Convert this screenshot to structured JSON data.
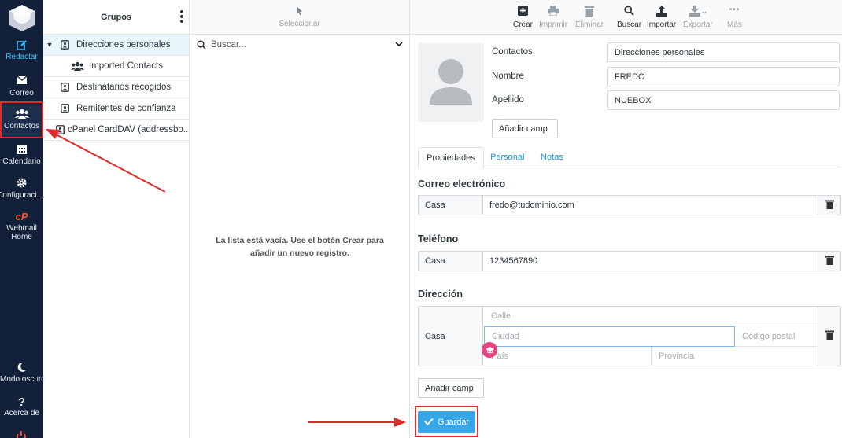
{
  "nav": {
    "items": [
      {
        "label": "Redactar",
        "icon": "compose-icon"
      },
      {
        "label": "Correo",
        "icon": "mail-icon"
      },
      {
        "label": "Contactos",
        "icon": "users-icon"
      },
      {
        "label": "Calendario",
        "icon": "calendar-icon"
      },
      {
        "label": "Configuraci...",
        "icon": "gear-icon"
      },
      {
        "label": "Webmail Home",
        "icon": "cpanel-icon"
      },
      {
        "label": "Modo oscuro",
        "icon": "moon-icon"
      },
      {
        "label": "Acerca de",
        "icon": "question-icon"
      }
    ]
  },
  "groups": {
    "title": "Grupos",
    "items": [
      {
        "label": "Direcciones personales"
      },
      {
        "label": "Imported Contacts"
      },
      {
        "label": "Destinatarios recogidos"
      },
      {
        "label": "Remitentes de confianza"
      },
      {
        "label": "cPanel CardDAV (addressbo..."
      }
    ]
  },
  "list": {
    "select_label": "Seleccionar",
    "search_placeholder": "Buscar...",
    "empty_message_line1": "La lista está vacía. Use el botón Crear para",
    "empty_message_line2": "añadir un nuevo registro."
  },
  "toolbar": {
    "create": "Crear",
    "print": "Imprimir",
    "delete": "Eliminar",
    "search": "Buscar",
    "import": "Importar",
    "export": "Exportar",
    "more": "Más"
  },
  "contact": {
    "label_contacts": "Contactos",
    "addressbook": "Direcciones personales",
    "label_name": "Nombre",
    "name": "FREDO",
    "label_surname": "Apellido",
    "surname": "NUEBOX",
    "add_field_top": "Añadir camp",
    "tabs": [
      "Propiedades",
      "Personal",
      "Notas"
    ],
    "email_section": "Correo electrónico",
    "email_type": "Casa",
    "email_value": "fredo@tudominio.com",
    "phone_section": "Teléfono",
    "phone_type": "Casa",
    "phone_value": "1234567890",
    "address_section": "Dirección",
    "address_type": "Casa",
    "street_ph": "Calle",
    "city_ph": "Ciudad",
    "zip_ph": "Código postal",
    "country_ph": "País",
    "province_ph": "Provincia",
    "add_field_bottom": "Añadir camp",
    "save": "Guardar"
  },
  "colors": {
    "nav_bg": "#13203a",
    "accent": "#37a6e8",
    "highlight_red": "#e02b2b"
  }
}
